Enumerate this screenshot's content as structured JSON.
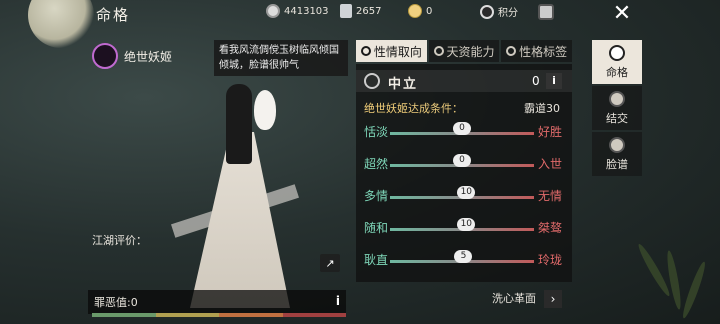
{
  "header": {
    "title": "命格",
    "currency1": "4413103",
    "currency2": "2657",
    "currency3": "0",
    "points_label": "积分"
  },
  "character": {
    "badge_label": "绝世妖姬",
    "quote": "看我风流倜傥玉树临风倾国倾城，脸谱很帅气",
    "jianghu_label": "江湖评价：",
    "evil_label": "罪恶值:0"
  },
  "tabs": [
    {
      "label": "性情取向"
    },
    {
      "label": "天资能力"
    },
    {
      "label": "性格标签"
    }
  ],
  "panel": {
    "neutral_label": "中立",
    "neutral_value": "0",
    "condition_name": "绝世妖姬",
    "condition_suffix": "达成条件：",
    "condition_right": "霸道30",
    "traits": [
      {
        "left": "恬淡",
        "right": "好胜",
        "value": "0",
        "pos": 0.5
      },
      {
        "left": "超然",
        "right": "入世",
        "value": "0",
        "pos": 0.5
      },
      {
        "left": "多情",
        "right": "无情",
        "value": "10",
        "pos": 0.53
      },
      {
        "left": "随和",
        "right": "桀骜",
        "value": "10",
        "pos": 0.53
      },
      {
        "left": "耿直",
        "right": "玲珑",
        "value": "5",
        "pos": 0.51
      }
    ],
    "reform_label": "洗心革面"
  },
  "side": [
    {
      "label": "命格"
    },
    {
      "label": "结交"
    },
    {
      "label": "脸谱"
    }
  ],
  "colors": {
    "accent_gold": "#f4d07a",
    "left_trait": "#7ed6b8",
    "right_trait": "#e06a6a"
  }
}
